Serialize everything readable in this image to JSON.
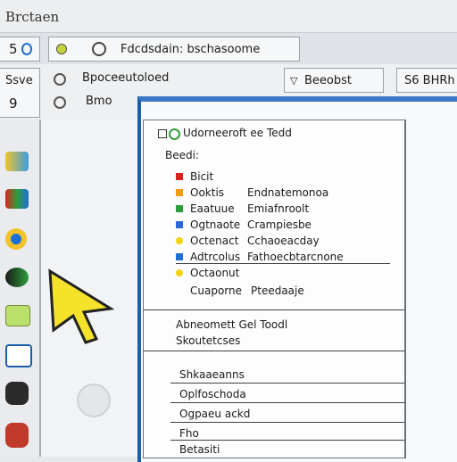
{
  "window": {
    "title": "Brctaen"
  },
  "toolbar": {
    "tab_number": "5",
    "address_text": "Fdcdsdain: bschasoome"
  },
  "row2": {
    "left_label": "Ssve",
    "left_number": "9",
    "mid_label_1": "Bpoceeutoloed",
    "mid_label_2": "Bmo",
    "dropdown_label": "Beeobst",
    "right_label": "S6 BHRh"
  },
  "panel": {
    "header": "Udorneeroft ee Tedd",
    "sub": "Beedi:",
    "items": [
      {
        "left": "Bicit",
        "right": "",
        "color": "#d9231e"
      },
      {
        "left": "Ooktis",
        "right": "Endnatemonoa",
        "color": "#f39c12"
      },
      {
        "left": "Eaatuue",
        "right": "Emiafnroolt",
        "color": "#2e9e3c"
      },
      {
        "left": "Ogtnaote",
        "right": "Crampiesbe",
        "color": "#2a6ad8"
      },
      {
        "left": "Octenact",
        "right": "Cchaoeacday",
        "color": "#f2d312"
      },
      {
        "left": "Adtrcolus",
        "right": "Fathoecbtarcnone",
        "color": "#1f6fd6"
      },
      {
        "left": "Octaonut",
        "right": "",
        "color": "#f2d312"
      },
      {
        "left": "Cuaporne",
        "right": "Pteedaaje",
        "color": ""
      }
    ],
    "section2_line1": "Abneomett Gel Toodl",
    "section2_line2": "Skoutetcses",
    "section3": [
      "Shkaaeanns",
      "Oplfoschoda",
      "Ogpaeu ackd",
      "Fho",
      "Betasiti"
    ]
  },
  "colors": {
    "accent_blue": "#1d5ea8",
    "cursor_yellow": "#f4e22b"
  },
  "icons": [
    "refresh-icon",
    "settings-icon",
    "grid-icon",
    "chrome-icon",
    "folder-icon",
    "palette-icon",
    "camera-icon",
    "power-icon",
    "arrow-cursor-icon"
  ]
}
